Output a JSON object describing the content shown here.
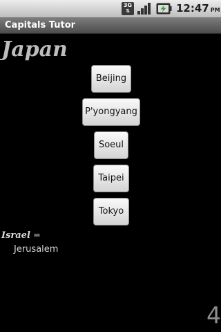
{
  "status_bar": {
    "network_type": "3G",
    "network_arrows": "⇅",
    "time": "12:47",
    "ampm": "PM",
    "icons": [
      "3g-icon",
      "signal-icon",
      "battery-charging-icon"
    ]
  },
  "app": {
    "title": "Capitals Tutor"
  },
  "question": {
    "country": "Japan"
  },
  "choices": [
    "Beijing",
    "P'yongyang",
    "Soeul",
    "Taipei",
    "Tokyo"
  ],
  "previous": {
    "country": "Israel",
    "equals": " =",
    "capital": "Jerusalem"
  },
  "score": "4",
  "colors": {
    "background": "#000000",
    "title_bar": "#5e5e5e",
    "status_bar": "#d4d4d4",
    "button_face": "#e6e6e6",
    "battery_accent": "#2e9a2e"
  }
}
